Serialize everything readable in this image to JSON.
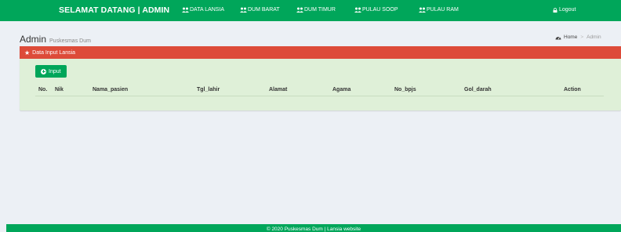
{
  "header": {
    "brand": "SELAMAT DATANG | ADMIN",
    "nav": [
      {
        "label": "DATA LANSIA",
        "icon": "users-icon"
      },
      {
        "label": "DUM BARAT",
        "icon": "users-icon"
      },
      {
        "label": "DUM TIMUR",
        "icon": "users-icon"
      },
      {
        "label": "PULAU SOOP",
        "icon": "users-icon"
      },
      {
        "label": "PULAU RAM",
        "icon": "users-icon"
      }
    ],
    "logout": "Logout"
  },
  "page": {
    "title": "Admin",
    "subtitle": "Puskesmas Dum",
    "breadcrumb": {
      "home": "Home",
      "current": "Admin"
    }
  },
  "box": {
    "title": "Data Input Lansia",
    "input_button": "Input",
    "columns": [
      "No.",
      "Nik",
      "Nama_pasien",
      "Tgl_lahir",
      "Alamat",
      "Agama",
      "No_bpjs",
      "Gol_darah",
      "Action"
    ]
  },
  "footer": {
    "text": "© 2020 Puskesmas Dum | Lansia website"
  },
  "colors": {
    "primary": "#00a65a",
    "danger": "#dd4b39",
    "box_bg": "#dff0d8",
    "page_bg": "#ecf0f5"
  }
}
